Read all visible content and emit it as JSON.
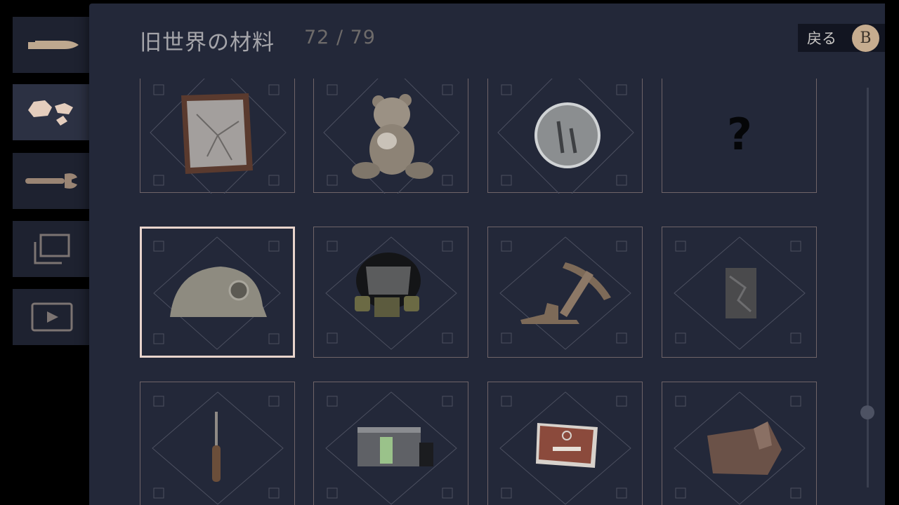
{
  "header": {
    "title": "旧世界の材料",
    "count": "72 / 79"
  },
  "back_button": {
    "label": "戻る",
    "key": "B"
  },
  "rail": {
    "items": [
      {
        "name": "ammo",
        "icon": "bullet-icon"
      },
      {
        "name": "materials",
        "icon": "rocks-icon",
        "active": true
      },
      {
        "name": "tools",
        "icon": "wrench-icon"
      },
      {
        "name": "gallery",
        "icon": "layered-frames-icon"
      },
      {
        "name": "videos",
        "icon": "play-icon"
      }
    ]
  },
  "grid": {
    "items": [
      {
        "id": "broken-frame",
        "icon": "cracked-picture-frame-icon"
      },
      {
        "id": "teddy-bear",
        "icon": "teddy-bear-icon"
      },
      {
        "id": "wall-clock",
        "icon": "clock-icon"
      },
      {
        "id": "unknown",
        "icon": "question-mark-icon",
        "text": "?"
      },
      {
        "id": "hard-hat",
        "icon": "helmet-icon",
        "selected": true
      },
      {
        "id": "gas-mask",
        "icon": "gas-mask-icon"
      },
      {
        "id": "pickaxe",
        "icon": "pickaxe-icon"
      },
      {
        "id": "stone-block",
        "icon": "stone-block-icon"
      },
      {
        "id": "screwdriver",
        "icon": "screwdriver-icon"
      },
      {
        "id": "film-device",
        "icon": "film-canister-icon"
      },
      {
        "id": "biohazard-case",
        "icon": "biohazard-case-icon"
      },
      {
        "id": "box",
        "icon": "crumpled-box-icon"
      }
    ]
  },
  "colors": {
    "accent": "#c6ac8f",
    "panel": "#232839",
    "card_border": "#6f6468",
    "selected_border": "#e8d4cc"
  }
}
